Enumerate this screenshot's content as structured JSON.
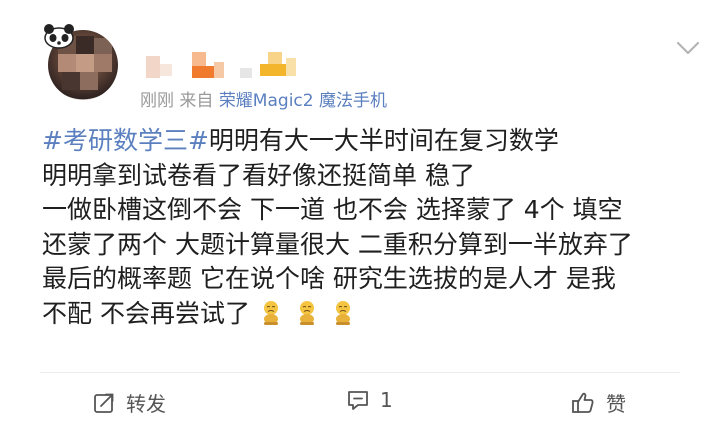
{
  "post": {
    "meta": {
      "time": "刚刚",
      "source_prefix": "来自",
      "device": "荣耀Magic2 魔法手机"
    },
    "content": {
      "hashtag": "#考研数学三#",
      "lines": [
        "明明有大一大半时间在复习数学",
        "明明拿到试卷看了看好像还挺简单 稳了",
        "一做卧槽这倒不会 下一道 也不会 选择蒙了 4个 填空",
        "还蒙了两个 大题计算量很大 二重积分算到一半放弃了",
        "最后的概率题 它在说个啥 研究生选拔的是人才 是我",
        "不配 不会再尝试了"
      ],
      "emojis": [
        "sad-sitting-emoji",
        "sad-sitting-emoji",
        "sad-sitting-emoji"
      ]
    },
    "actions": {
      "repost_label": "转发",
      "comment_count": "1",
      "like_label": "赞"
    }
  },
  "colors": {
    "link": "#5b7fbf",
    "meta": "#9a9a9a",
    "text": "#1f1f1f",
    "icon": "#555555"
  }
}
